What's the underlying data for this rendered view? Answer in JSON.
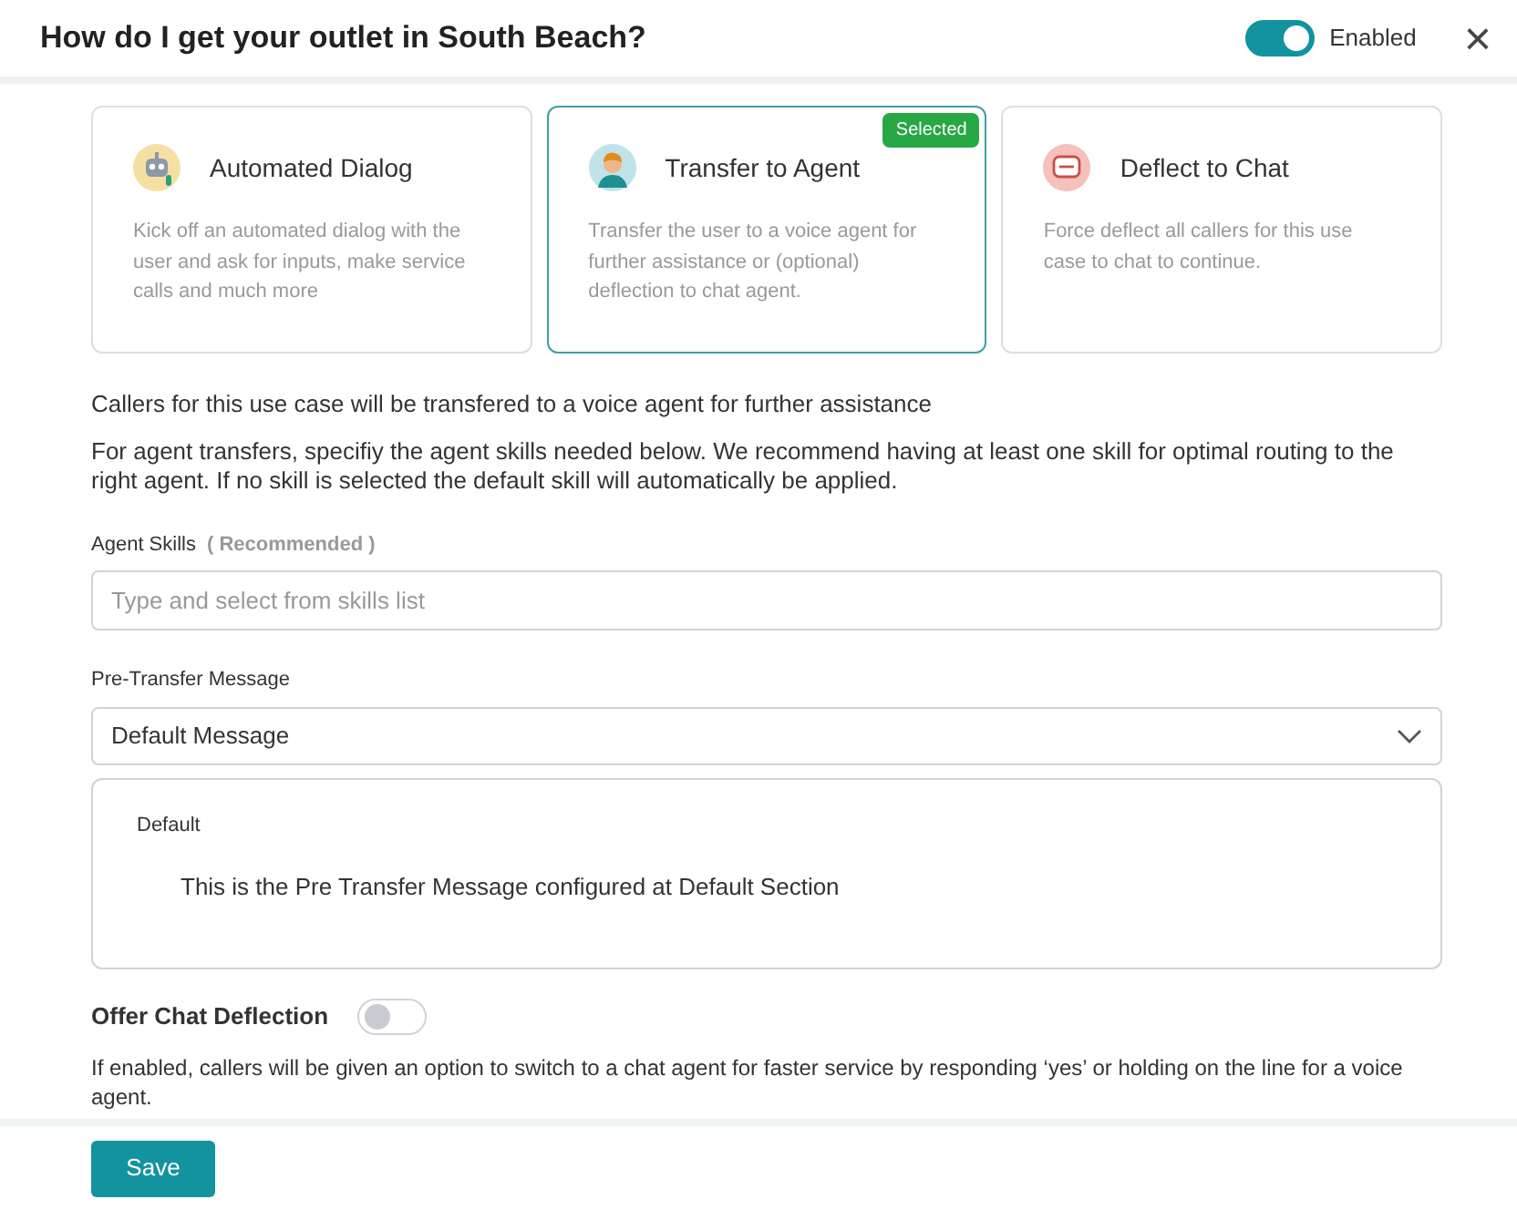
{
  "header": {
    "title": "How do I get your outlet in South Beach?",
    "toggle": {
      "on": true,
      "label": "Enabled"
    },
    "close": "×"
  },
  "options": [
    {
      "kind": "robot",
      "title": "Automated Dialog",
      "description": "Kick off an automated dialog with the user and ask for inputs, make service calls and much more",
      "selected": false
    },
    {
      "kind": "agent",
      "title": "Transfer to Agent",
      "description": "Transfer the user to a voice agent for further assistance or (optional) deflection to chat agent.",
      "selected": true,
      "badge": "Selected"
    },
    {
      "kind": "chat",
      "title": "Deflect to Chat",
      "description": "Force deflect all callers for this use case to chat to continue.",
      "selected": false
    }
  ],
  "summary": "Callers for this use case will be transfered to a voice agent for further assistance",
  "note": "For agent transfers, specifiy the agent skills needed below. We recommend having at least one skill for optimal routing to the right agent. If no skill is selected the default skill will automatically be applied.",
  "skills": {
    "label": "Agent Skills",
    "hint": "( Recommended )",
    "placeholder": "Type and select from skills list"
  },
  "message": {
    "label": "Pre-Transfer Message",
    "value": "Default Message",
    "preview_title": "Default",
    "preview_text": "This is the Pre Transfer Message configured at Default Section"
  },
  "deflection": {
    "label": "Offer Chat Deflection",
    "on": false,
    "help": "If enabled, callers will be given an option to switch to a chat agent for faster service by responding ‘yes’ or holding on the line for a voice agent."
  },
  "save": "Save"
}
